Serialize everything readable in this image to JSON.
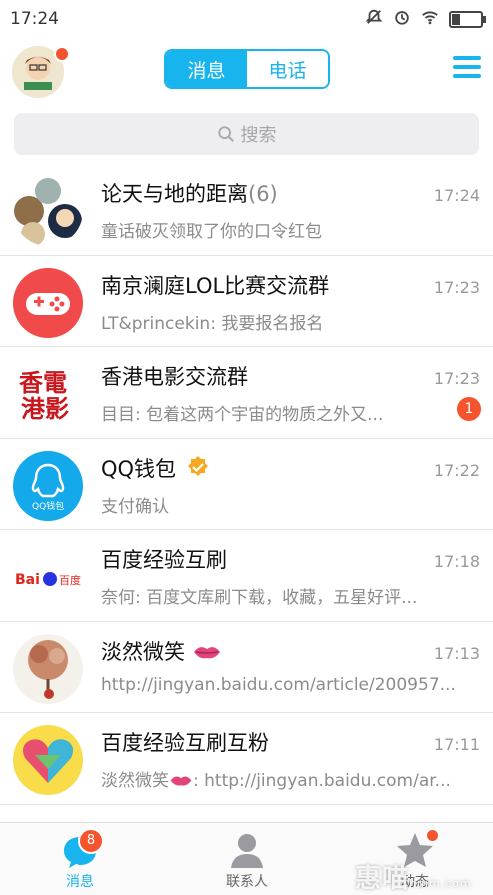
{
  "statusbar": {
    "time": "17:24"
  },
  "header": {
    "tab_messages": "消息",
    "tab_calls": "电话"
  },
  "search": {
    "placeholder": "搜索"
  },
  "conversations": [
    {
      "name": "论天与地的距离",
      "count": "(6)",
      "message": "童话破灭领取了你的口令红包",
      "time": "17:24"
    },
    {
      "name": "南京澜庭LOL比赛交流群",
      "message": "LT&princekin: 我要报名报名",
      "time": "17:23"
    },
    {
      "name": "香港电影交流群",
      "message": "目目: 包着这两个宇宙的物质之外又...",
      "time": "17:23",
      "badge": "1"
    },
    {
      "name": "QQ钱包",
      "message": "支付确认",
      "time": "17:22"
    },
    {
      "name": "百度经验互刷",
      "message": "奈何: 百度文库刷下载，收藏，五星好评...",
      "time": "17:18"
    },
    {
      "name": "淡然微笑",
      "message": "http://jingyan.baidu.com/article/200957...",
      "time": "17:13"
    },
    {
      "name": "百度经验互刷互粉",
      "message": "淡然微笑",
      "message_link": ": http://jingyan.baidu.com/ar...",
      "time": "17:11"
    }
  ],
  "tabbar": {
    "messages_label": "消息",
    "messages_badge": "8",
    "contacts_label": "联系人",
    "feed_label": "动态"
  },
  "watermark": {
    "text": "惠喵",
    "sub": "huim.com"
  },
  "colors": {
    "accent": "#18b4ed",
    "badge": "#f5542f"
  }
}
